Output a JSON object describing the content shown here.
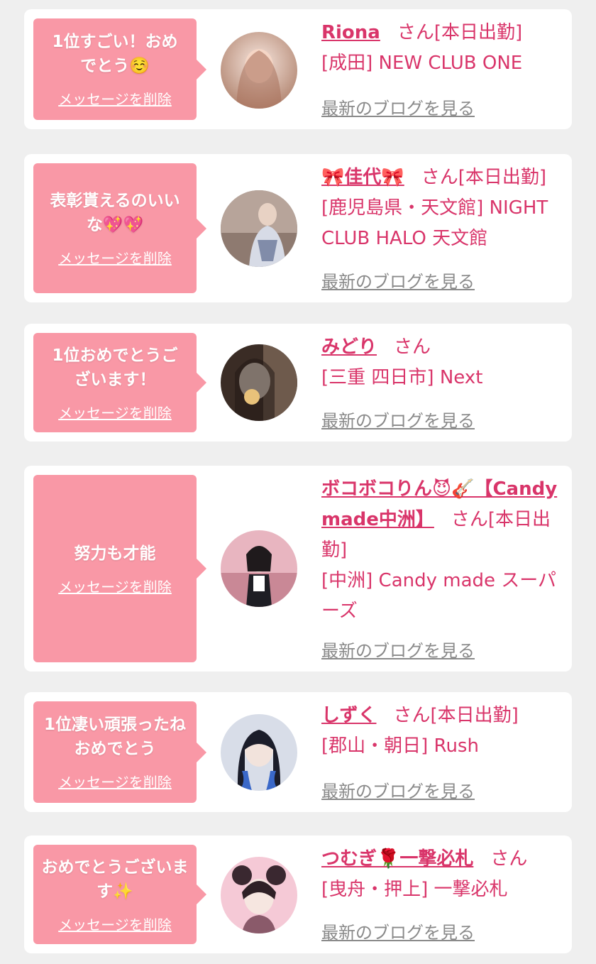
{
  "labels": {
    "delete": "メッセージを削除",
    "blog": "最新のブログを見る"
  },
  "colors": {
    "bubble": "#f998a6",
    "accent": "#d9356a",
    "link_gray": "#8a8a8a",
    "background": "#efefef"
  },
  "cards": [
    {
      "message": "1位すごい！おめでとう☺️",
      "name": "Riona",
      "san": "さん",
      "status": "[本日出勤]",
      "location": "[成田] NEW CLUB ONE",
      "avatar_colors": [
        "#f2ddd4",
        "#b58a76"
      ]
    },
    {
      "message": "表彰貰えるのいいな💖💖",
      "name": "🎀佳代🎀",
      "san": "さん",
      "status": "[本日出勤]",
      "location": "[鹿児島県・天文館] NIGHT CLUB HALO 天文館",
      "avatar_colors": [
        "#c7b6ad",
        "#6f5b52"
      ]
    },
    {
      "message": "1位おめでとうございます！",
      "name": "みどり",
      "san": "さん",
      "status": "",
      "location": "[三重 四日市] Next",
      "avatar_colors": [
        "#d8c7b4",
        "#3b2d26"
      ]
    },
    {
      "message": "努力も才能",
      "name": "ボコボコりん😈🎸【Candy made中洲】",
      "san": "さん",
      "status": "[本日出勤]",
      "location": "[中洲] Candy made スーパーズ",
      "avatar_colors": [
        "#f0c6cf",
        "#9b6a74"
      ]
    },
    {
      "message": "1位凄い頑張ったねおめでとう",
      "name": "しずく",
      "san": "さん",
      "status": "[本日出勤]",
      "location": "[郡山・朝日] Rush",
      "avatar_colors": [
        "#cfd7e6",
        "#2d2f4a"
      ]
    },
    {
      "message": "おめでとうございます✨",
      "name": "つむぎ🌹一撃必札",
      "san": "さん",
      "status": "",
      "location": "[曳舟・押上] 一撃必札",
      "avatar_colors": [
        "#f4c4d2",
        "#4a3038"
      ]
    }
  ]
}
